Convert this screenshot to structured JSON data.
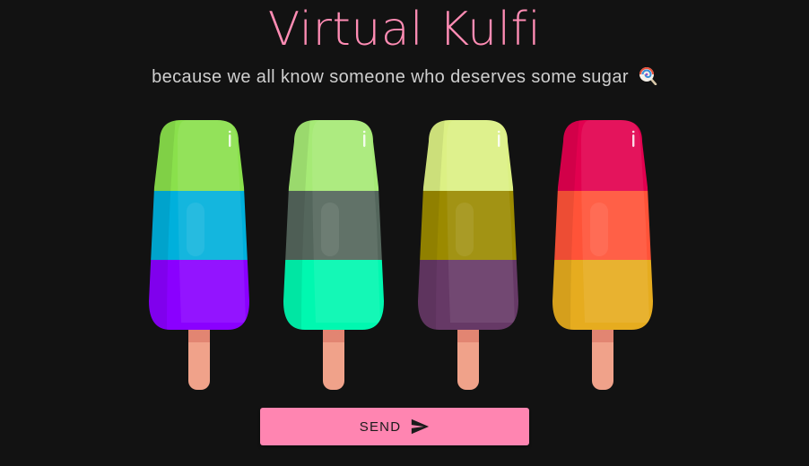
{
  "header": {
    "title": "Virtual Kulfi",
    "subtitle": "because we all know someone who deserves some sugar",
    "subtitle_icon": "lollipop-icon"
  },
  "kulfis": [
    {
      "colors": {
        "top": "#8ae04c",
        "middle": "#00b0dc",
        "bottom": "#8a00ff"
      }
    },
    {
      "colors": {
        "top": "#a6ea76",
        "middle": "#54665c",
        "bottom": "#00f8b0"
      }
    },
    {
      "colors": {
        "top": "#dcf084",
        "middle": "#9b8a00",
        "bottom": "#663966"
      }
    },
    {
      "colors": {
        "top": "#e2004f",
        "middle": "#ff5338",
        "bottom": "#e6ac1f"
      }
    }
  ],
  "theme": {
    "background": "#121212",
    "accent": "#ff85b1",
    "stick": "#f0a28a"
  },
  "actions": {
    "send_label": "SEND",
    "send_icon": "send-icon"
  }
}
